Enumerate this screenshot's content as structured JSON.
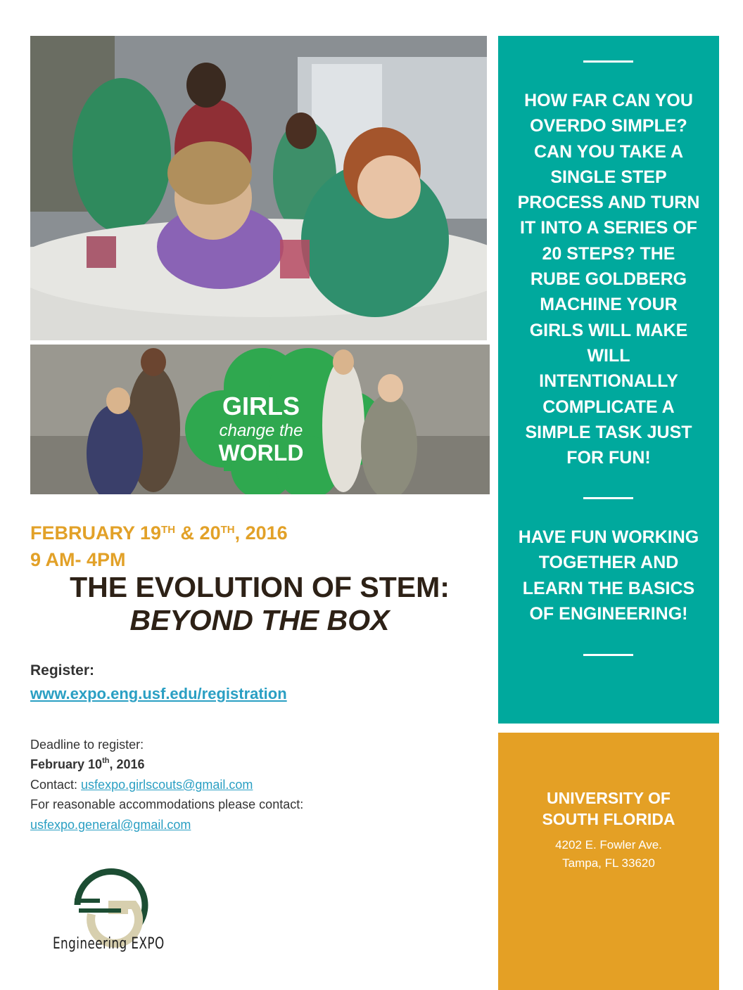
{
  "event": {
    "date_line1_a": "FEBRUARY 19",
    "date_line1_sup1": "TH",
    "date_line1_b": " & 20",
    "date_line1_sup2": "TH",
    "date_line1_c": ", 2016",
    "time_line": "9 AM- 4PM",
    "title_line1": "THE EVOLUTION OF STEM:",
    "title_line2": "BEYOND THE BOX"
  },
  "photos": {
    "photo1_icon": "girls-science-experiment-photo",
    "photo2_icon": "girls-change-the-world-photo",
    "banner_line1": "GIRLS",
    "banner_line2": "change the",
    "banner_line3": "WORLD"
  },
  "registration": {
    "label": "Register:",
    "url": "www.expo.eng.usf.edu/registration",
    "deadline_label": "Deadline to register:",
    "deadline_a": "February 10",
    "deadline_sup": "th",
    "deadline_b": ", 2016",
    "contact_label": "Contact: ",
    "contact_email": "usfexpo.girlscouts@gmail.com",
    "accommodations_label": "For reasonable accommodations please contact:",
    "accommodations_email": "usfexpo.general@gmail.com"
  },
  "logo": {
    "text": "Engineering EXPO",
    "colors": {
      "green": "#1c4d33",
      "tan": "#d7cfae"
    }
  },
  "sidebar": {
    "paragraph1": "HOW FAR CAN YOU OVERDO SIMPLE? CAN YOU TAKE A SINGLE STEP PROCESS AND TURN IT INTO A SERIES OF 20 STEPS? THE RUBE GOLDBERG MACHINE YOUR GIRLS WILL MAKE WILL INTENTIONALLY COMPLICATE A SIMPLE TASK JUST FOR FUN!",
    "paragraph1_lines": [
      "HOW FAR CAN YOU",
      "OVERDO SIMPLE?",
      "CAN YOU TAKE A",
      "SINGLE STEP",
      "PROCESS AND TURN",
      "IT INTO A SERIES OF",
      "20 STEPS? THE",
      "RUBE GOLDBERG",
      "MACHINE YOUR",
      "GIRLS WILL MAKE",
      "WILL",
      "INTENTIONALLY",
      "COMPLICATE A",
      "SIMPLE TASK JUST",
      "FOR FUN!"
    ],
    "paragraph2_lines": [
      "HAVE FUN WORKING",
      "TOGETHER AND",
      "LEARN THE BASICS",
      "OF ENGINEERING!"
    ],
    "colors": {
      "teal": "#00a99d",
      "orange": "#e4a025"
    }
  },
  "location": {
    "name_line1": "UNIVERSITY OF",
    "name_line2": "SOUTH FLORIDA",
    "address_line1": "4202 E. Fowler Ave.",
    "address_line2": "Tampa, FL 33620"
  }
}
